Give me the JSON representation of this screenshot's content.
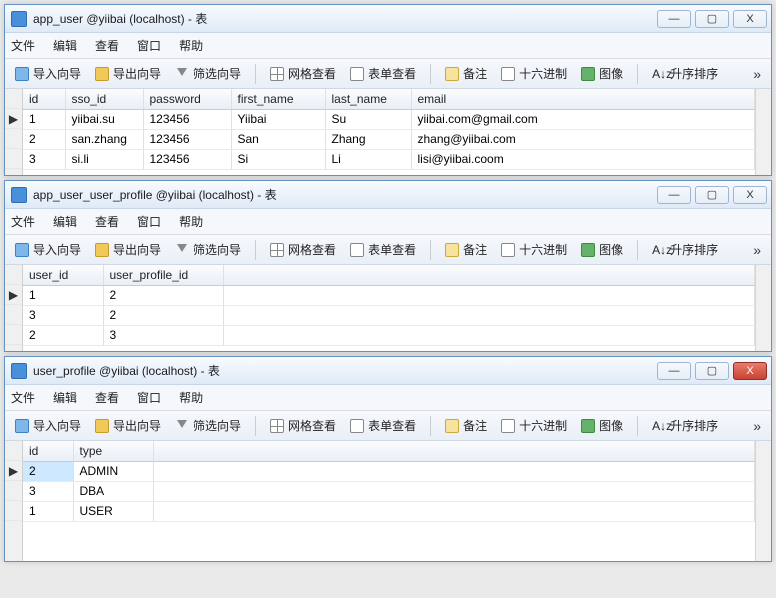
{
  "menu": {
    "file": "文件",
    "edit": "编辑",
    "view": "查看",
    "window": "窗口",
    "help": "帮助"
  },
  "toolbar": {
    "import": "导入向导",
    "export": "导出向导",
    "filter": "筛选向导",
    "gridview": "网格查看",
    "formview": "表单查看",
    "memo": "备注",
    "hex": "十六进制",
    "image": "图像",
    "sort_prefix": "A↓z",
    "sort": "升序排序",
    "more": "»"
  },
  "winctl": {
    "min": "—",
    "max": "▢",
    "close": "X"
  },
  "row_marker": "▶",
  "w1": {
    "title": "app_user @yiibai (localhost) - 表",
    "cols": [
      "id",
      "sso_id",
      "password",
      "first_name",
      "last_name",
      "email"
    ],
    "rows": [
      {
        "id": "1",
        "sso_id": "yiibai.su",
        "password": "123456",
        "first_name": "Yiibai",
        "last_name": "Su",
        "email": "yiibai.com@gmail.com"
      },
      {
        "id": "2",
        "sso_id": "san.zhang",
        "password": "123456",
        "first_name": "San",
        "last_name": "Zhang",
        "email": "zhang@yiibai.com"
      },
      {
        "id": "3",
        "sso_id": "si.li",
        "password": "123456",
        "first_name": "Si",
        "last_name": "Li",
        "email": "lisi@yiibai.coom"
      }
    ]
  },
  "w2": {
    "title": "app_user_user_profile @yiibai (localhost) - 表",
    "cols": [
      "user_id",
      "user_profile_id"
    ],
    "rows": [
      {
        "user_id": "1",
        "user_profile_id": "2"
      },
      {
        "user_id": "3",
        "user_profile_id": "2"
      },
      {
        "user_id": "2",
        "user_profile_id": "3"
      }
    ]
  },
  "w3": {
    "title": "user_profile @yiibai (localhost) - 表",
    "cols": [
      "id",
      "type"
    ],
    "rows": [
      {
        "id": "2",
        "type": "ADMIN"
      },
      {
        "id": "3",
        "type": "DBA"
      },
      {
        "id": "1",
        "type": "USER"
      }
    ]
  }
}
